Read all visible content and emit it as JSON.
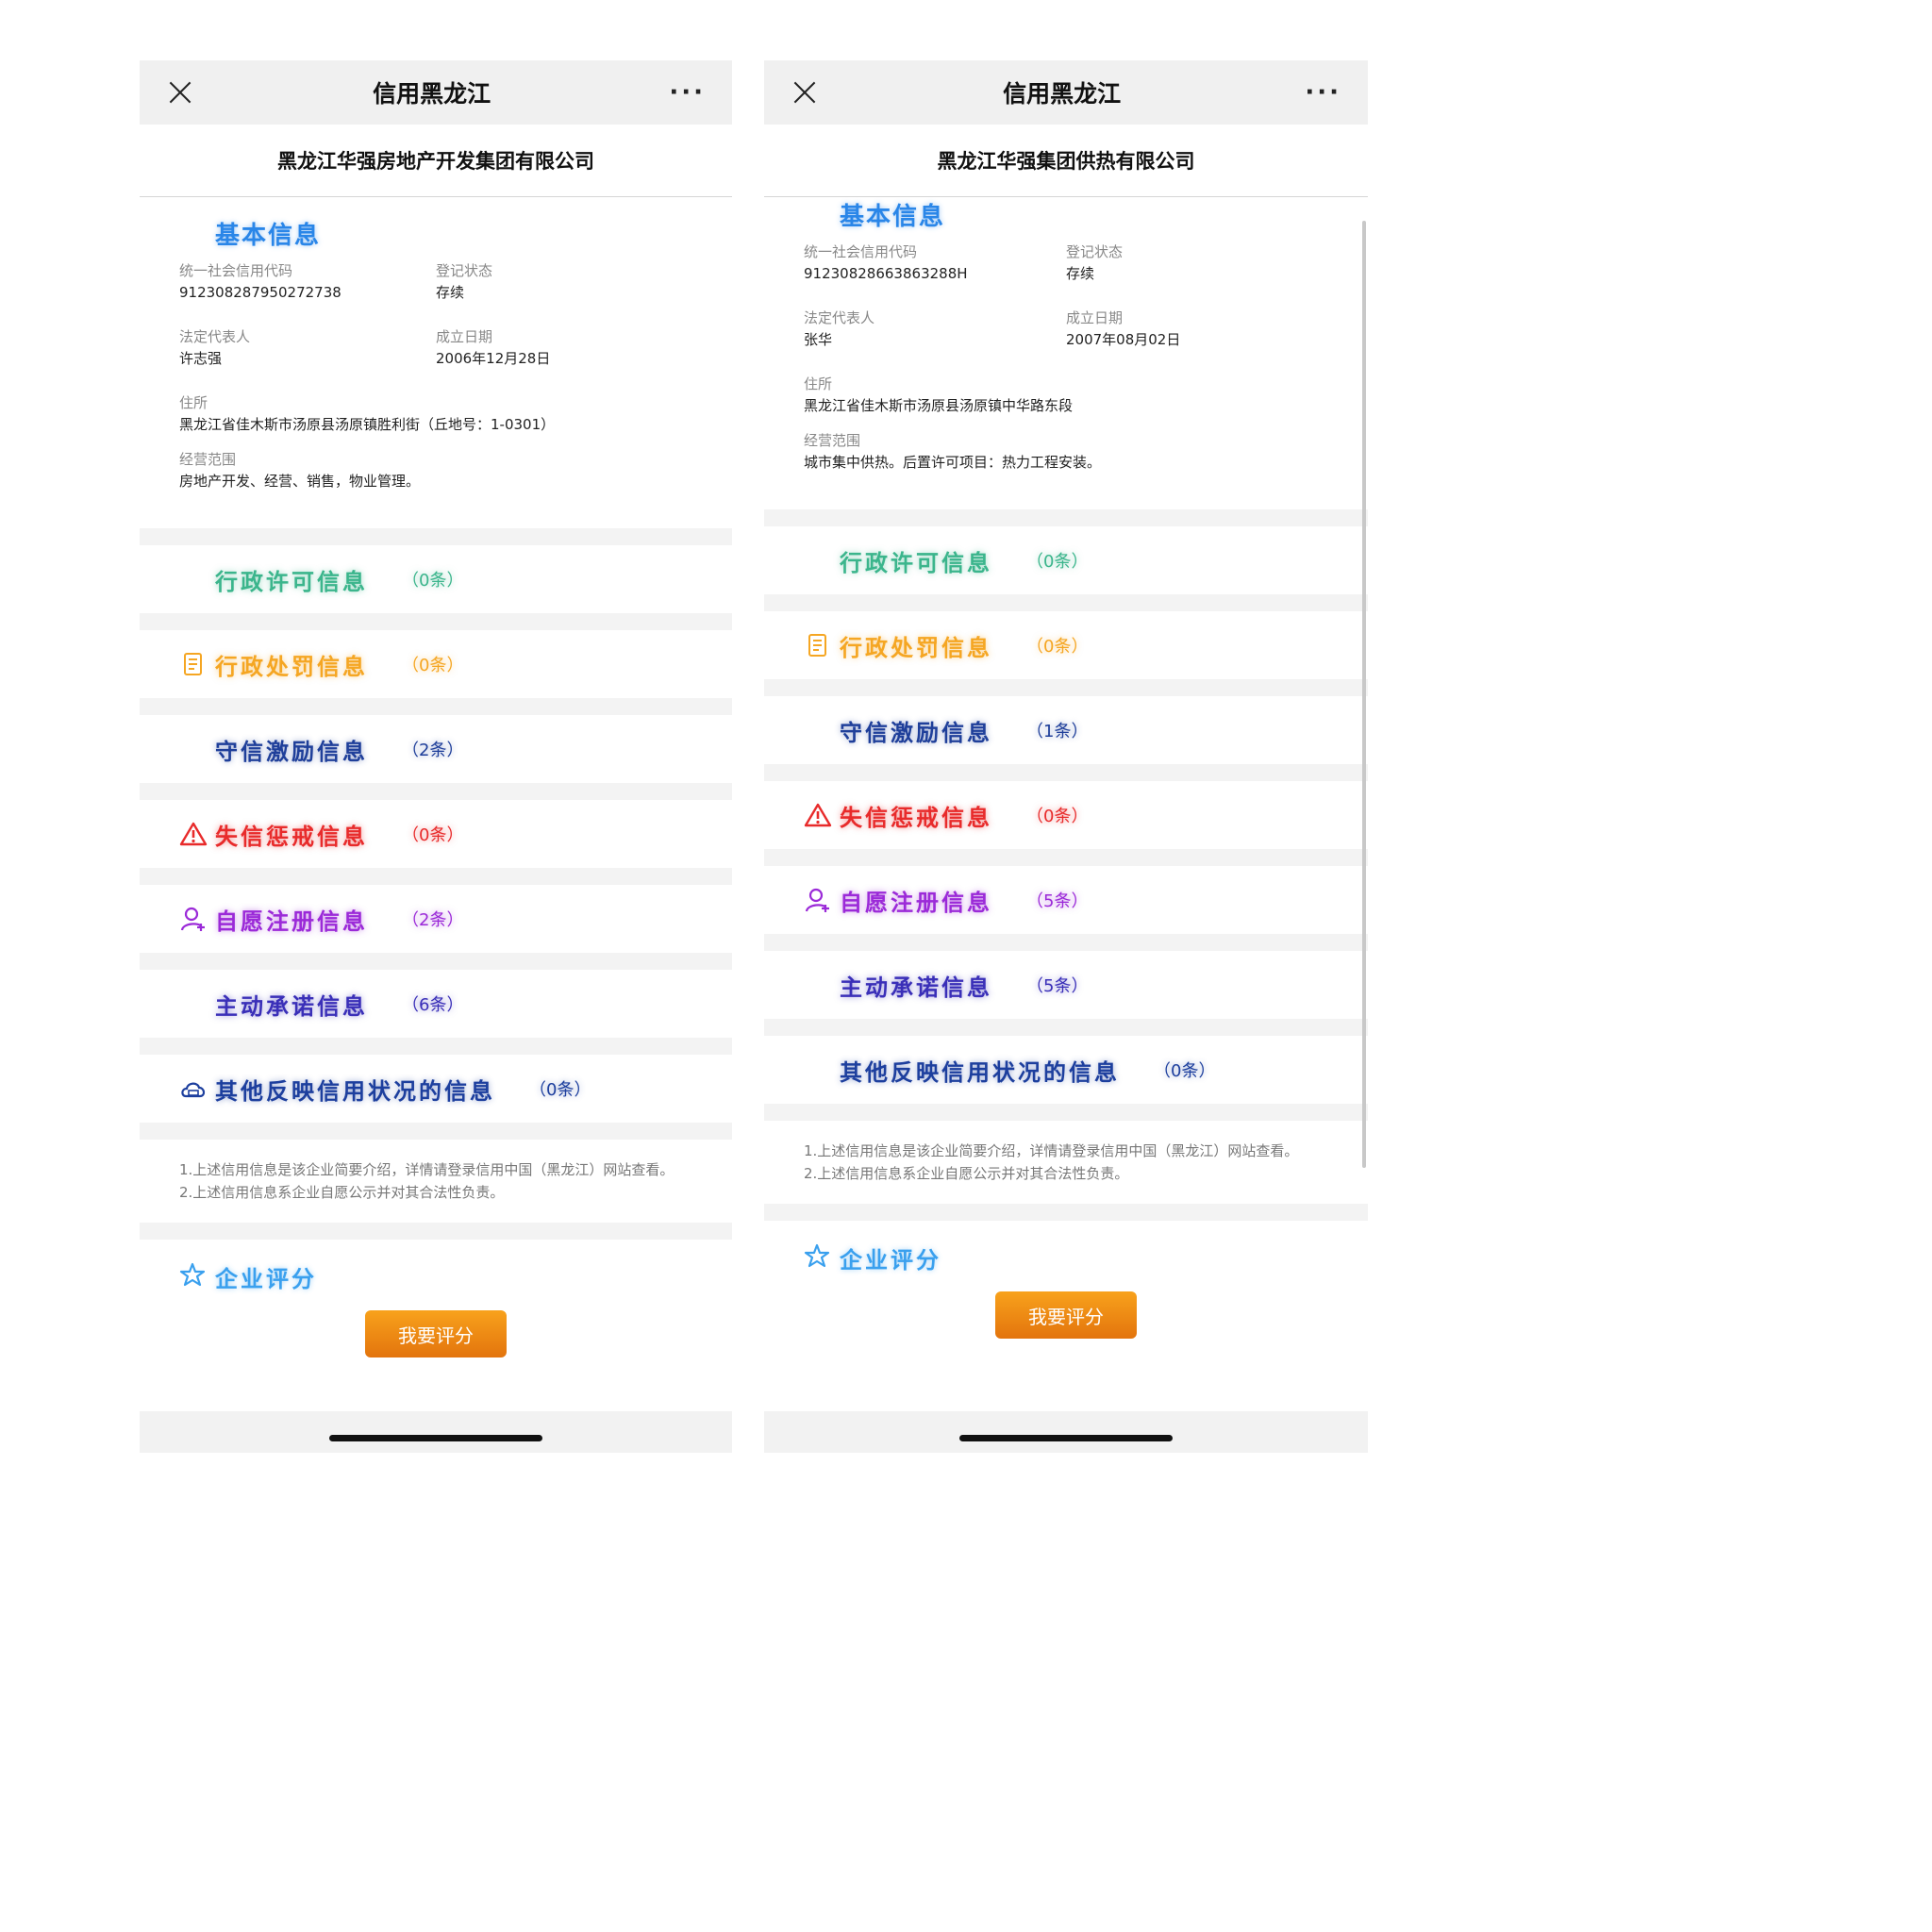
{
  "common": {
    "app_title": "信用黑龙江",
    "more_label": "···",
    "basic_title": "基本信息",
    "labels": {
      "credit_code": "统一社会信用代码",
      "status": "登记状态",
      "legal_rep": "法定代表人",
      "found_date": "成立日期",
      "address": "住所",
      "scope": "经营范围"
    },
    "sections": {
      "permit": "行政许可信息",
      "penalty": "行政处罚信息",
      "incentive": "守信激励信息",
      "discipline": "失信惩戒信息",
      "register": "自愿注册信息",
      "commitment": "主动承诺信息",
      "other": "其他反映信用状况的信息"
    },
    "note1": "1.上述信用信息是该企业简要介绍，详情请登录信用中国（黑龙江）网站查看。",
    "note2": "2.上述信用信息系企业自愿公示并对其合法性负责。",
    "rating_title": "企业评分",
    "rate_button": "我要评分",
    "colors": {
      "basic": "#2a86e8",
      "permit": "#3bb58c",
      "penalty": "#f5a623",
      "incentive": "#1f3f9a",
      "discipline": "#e82b2b",
      "register": "#9b2ad8",
      "commitment": "#3a2fb8",
      "other": "#1d3f9e",
      "button": "#e3740d"
    },
    "icons": {
      "penalty": "document-icon",
      "discipline": "warning-icon",
      "register": "user-add-icon",
      "other": "cloud-icon",
      "rating": "star-icon"
    }
  },
  "left": {
    "company": "黑龙江华强房地产开发集团有限公司",
    "credit_code": "912308287950272738",
    "status": "存续",
    "legal_rep": "许志强",
    "found_date": "2006年12月28日",
    "address": "黑龙江省佳木斯市汤原县汤原镇胜利街（丘地号：1-0301）",
    "scope": "房地产开发、经营、销售，物业管理。",
    "counts": {
      "permit": "（0条）",
      "penalty": "（0条）",
      "incentive": "（2条）",
      "discipline": "（0条）",
      "register": "（2条）",
      "commitment": "（6条）",
      "other": "（0条）"
    }
  },
  "right": {
    "company": "黑龙江华强集团供热有限公司",
    "credit_code": "91230828663863288H",
    "status": "存续",
    "legal_rep": "张华",
    "found_date": "2007年08月02日",
    "address": "黑龙江省佳木斯市汤原县汤原镇中华路东段",
    "scope": "城市集中供热。后置许可项目：热力工程安装。",
    "counts": {
      "permit": "（0条）",
      "penalty": "（0条）",
      "incentive": "（1条）",
      "discipline": "（0条）",
      "register": "（5条）",
      "commitment": "（5条）",
      "other": "（0条）"
    }
  }
}
